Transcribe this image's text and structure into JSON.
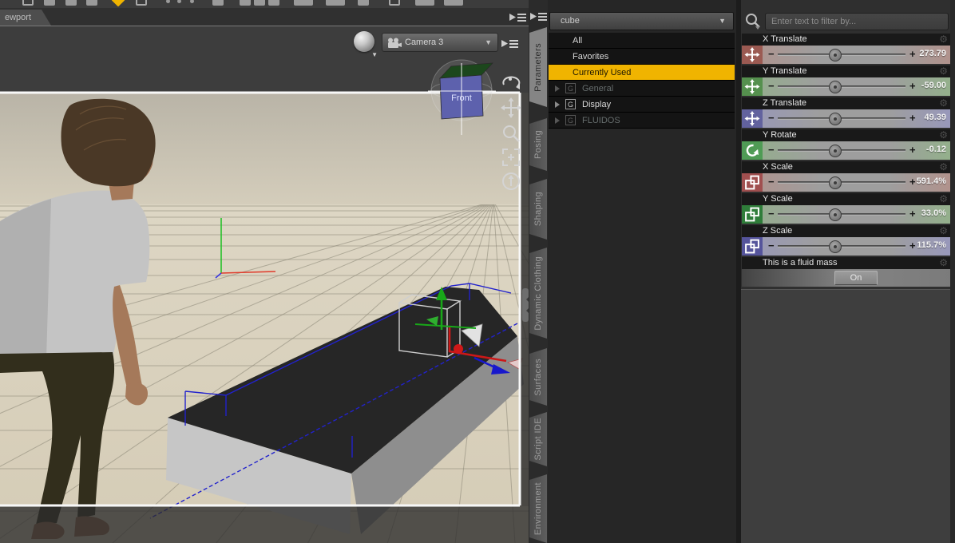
{
  "window": {
    "viewport_tab": "ewport"
  },
  "viewport": {
    "camera_dropdown_label": "Camera 3",
    "view_cube_label": "Front",
    "tools": [
      "orbit",
      "pan",
      "zoom",
      "frame",
      "aim"
    ]
  },
  "side_tabs": [
    {
      "label": "Parameters",
      "active": true
    },
    {
      "label": "Posing",
      "active": false
    },
    {
      "label": "Shaping",
      "active": false
    },
    {
      "label": "Dynamic Clothing",
      "active": false
    },
    {
      "label": "Surfaces",
      "active": false
    },
    {
      "label": "Script IDE",
      "active": false
    },
    {
      "label": "Environment",
      "active": false
    }
  ],
  "scene_panel": {
    "selector_value": "cube",
    "items": [
      {
        "label": "All",
        "style": "plain"
      },
      {
        "label": "Favorites",
        "style": "plain"
      },
      {
        "label": "Currently Used",
        "style": "selected"
      },
      {
        "label": "General",
        "style": "group-dim"
      },
      {
        "label": "Display",
        "style": "group"
      },
      {
        "label": "FLUIDOS",
        "style": "group-dim"
      }
    ]
  },
  "params_panel": {
    "filter_placeholder": "Enter text to filter by...",
    "sliders": [
      {
        "label": "X Translate",
        "value": "273.79",
        "icon": "move",
        "icon_bg": "#9b5a52",
        "tint": "#b1928c"
      },
      {
        "label": "Y Translate",
        "value": "-59.00",
        "icon": "move",
        "icon_bg": "#55904e",
        "tint": "#93b08b"
      },
      {
        "label": "Z Translate",
        "value": "49.39",
        "icon": "move",
        "icon_bg": "#62629e",
        "tint": "#9898bb"
      },
      {
        "label": "Y Rotate",
        "value": "-0.12",
        "icon": "rotate",
        "icon_bg": "#4f9b55",
        "tint": "#93b08b"
      },
      {
        "label": "X Scale",
        "value": "591.4%",
        "icon": "scale",
        "icon_bg": "#a04f4f",
        "tint": "#b1928c"
      },
      {
        "label": "Y Scale",
        "value": "33.0%",
        "icon": "scale",
        "icon_bg": "#2f7d3a",
        "tint": "#93b08b"
      },
      {
        "label": "Z Scale",
        "value": "115.7%",
        "icon": "scale",
        "icon_bg": "#55549b",
        "tint": "#9898bb"
      }
    ],
    "toggle": {
      "label": "This is a fluid mass",
      "state": "On"
    },
    "slider_handle_pos": 0.45
  },
  "colors": {
    "highlight": "#f0b400",
    "axis_x": "#cc1818",
    "axis_y": "#18a818",
    "axis_z": "#1818cc"
  }
}
